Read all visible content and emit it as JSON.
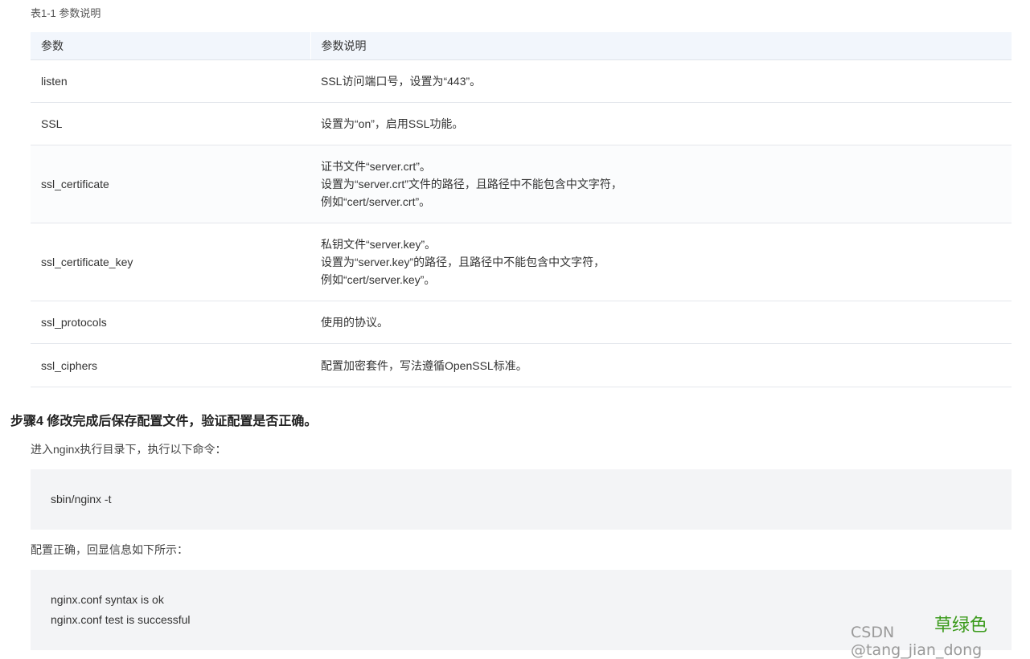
{
  "table": {
    "caption": "表1-1 参数说明",
    "headers": [
      "参数",
      "参数说明"
    ],
    "rows": [
      {
        "param": "listen",
        "desc": [
          "SSL访问端口号，设置为“443”。"
        ]
      },
      {
        "param": "SSL",
        "desc": [
          "设置为“on”，启用SSL功能。"
        ]
      },
      {
        "param": "ssl_certificate",
        "desc": [
          "证书文件“server.crt”。",
          "设置为“server.crt”文件的路径，且路径中不能包含中文字符，",
          "例如“cert/server.crt”。"
        ]
      },
      {
        "param": "ssl_certificate_key",
        "desc": [
          "私钥文件“server.key”。",
          "设置为“server.key”的路径，且路径中不能包含中文字符，",
          "例如“cert/server.key”。"
        ]
      },
      {
        "param": "ssl_protocols",
        "desc": [
          "使用的协议。"
        ]
      },
      {
        "param": "ssl_ciphers",
        "desc": [
          "配置加密套件，写法遵循OpenSSL标准。"
        ]
      }
    ]
  },
  "step": {
    "heading": "步骤4 修改完成后保存配置文件，验证配置是否正确。",
    "instruction_1": "进入nginx执行目录下，执行以下命令：",
    "command": "sbin/nginx -t",
    "instruction_2": "配置正确，回显信息如下所示：",
    "output": [
      "nginx.conf syntax is ok",
      "nginx.conf test is successful"
    ]
  },
  "overlay": {
    "sticker_text": "草绿色",
    "watermark": "CSDN @tang_jian_dong"
  }
}
